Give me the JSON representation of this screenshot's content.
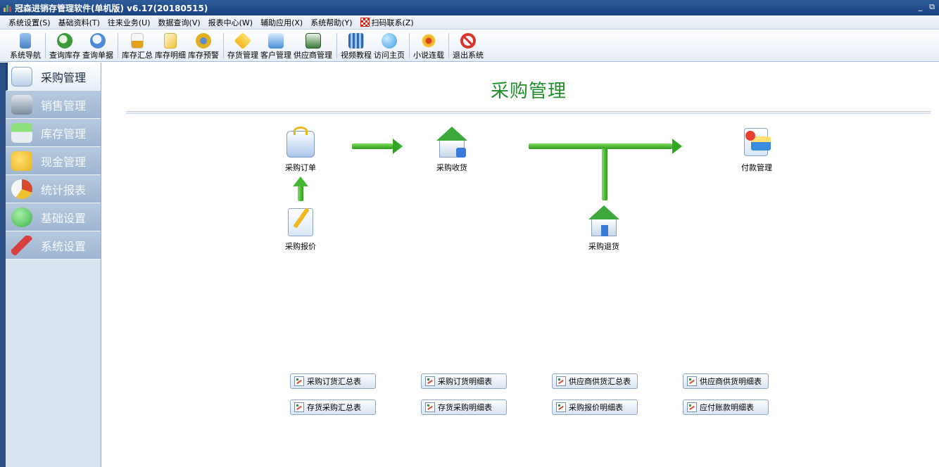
{
  "window": {
    "title": "冠森进销存管理软件(单机版) v6.17(20180515)",
    "minimize": "_",
    "restore": "⧉"
  },
  "menus": [
    {
      "label": "系统设置(S)"
    },
    {
      "label": "基础资料(T)"
    },
    {
      "label": "往来业务(U)"
    },
    {
      "label": "数据查询(V)"
    },
    {
      "label": "报表中心(W)"
    },
    {
      "label": "辅助应用(X)"
    },
    {
      "label": "系统帮助(Y)"
    },
    {
      "label": "扫码联系(Z)",
      "icon": "qr-code-icon"
    }
  ],
  "toolbar": [
    {
      "label": "系统导航",
      "icon": "navigation-icon",
      "color": "#4a7fc4"
    },
    {
      "label": "查询库存",
      "icon": "inventory-query-icon",
      "color": "#3b9a3b"
    },
    {
      "label": "查询单据",
      "icon": "document-query-icon",
      "color": "#4c8ad6"
    },
    {
      "label": "库存汇总",
      "icon": "stock-summary-icon",
      "color": "#e3a21a"
    },
    {
      "label": "库存明细",
      "icon": "stock-detail-icon",
      "color": "#f0c03a"
    },
    {
      "label": "库存预警",
      "icon": "stock-alert-icon",
      "color": "#e0b020"
    },
    {
      "label": "存货管理",
      "icon": "goods-icon",
      "color": "#f2b61c"
    },
    {
      "label": "客户管理",
      "icon": "customer-icon",
      "color": "#4a8fd8"
    },
    {
      "label": "供应商管理",
      "icon": "supplier-icon",
      "color": "#3a7a3a"
    },
    {
      "label": "视频教程",
      "icon": "video-icon",
      "color": "#2a6ab8"
    },
    {
      "label": "访问主页",
      "icon": "globe-icon",
      "color": "#3a9ae0"
    },
    {
      "label": "小说连载",
      "icon": "flower-icon",
      "color": "#e8a020"
    },
    {
      "label": "退出系统",
      "icon": "exit-icon",
      "color": "#d8342a"
    }
  ],
  "sidebar": [
    {
      "label": "采购管理",
      "icon": "purchase-bag-icon",
      "active": true,
      "color": "#f0c030"
    },
    {
      "label": "销售管理",
      "icon": "cash-register-icon",
      "active": false,
      "color": "#7a8a9a"
    },
    {
      "label": "库存管理",
      "icon": "warehouse-icon",
      "active": false,
      "color": "#3aa040"
    },
    {
      "label": "现金管理",
      "icon": "coins-icon",
      "active": false,
      "color": "#e8b020"
    },
    {
      "label": "统计报表",
      "icon": "report-icon",
      "active": false,
      "color": "#d84a2a"
    },
    {
      "label": "基础设置",
      "icon": "check-icon",
      "active": false,
      "color": "#3ab048"
    },
    {
      "label": "系统设置",
      "icon": "tools-icon",
      "active": false,
      "color": "#d84040"
    }
  ],
  "main": {
    "title": "采购管理",
    "nodes": {
      "purchase_order": {
        "label": "采购订单",
        "icon": "purchase-order-icon"
      },
      "purchase_receipt": {
        "label": "采购收货",
        "icon": "purchase-receipt-icon"
      },
      "payment": {
        "label": "付款管理",
        "icon": "payment-icon"
      },
      "quotation": {
        "label": "采购报价",
        "icon": "quotation-icon"
      },
      "purchase_return": {
        "label": "采购退货",
        "icon": "purchase-return-icon"
      }
    },
    "reports": [
      {
        "label": "采购订货汇总表"
      },
      {
        "label": "采购订货明细表"
      },
      {
        "label": "供应商供货汇总表"
      },
      {
        "label": "供应商供货明细表"
      },
      {
        "label": "存货采购汇总表"
      },
      {
        "label": "存货采购明细表"
      },
      {
        "label": "采购报价明细表"
      },
      {
        "label": "应付账款明细表"
      }
    ]
  }
}
